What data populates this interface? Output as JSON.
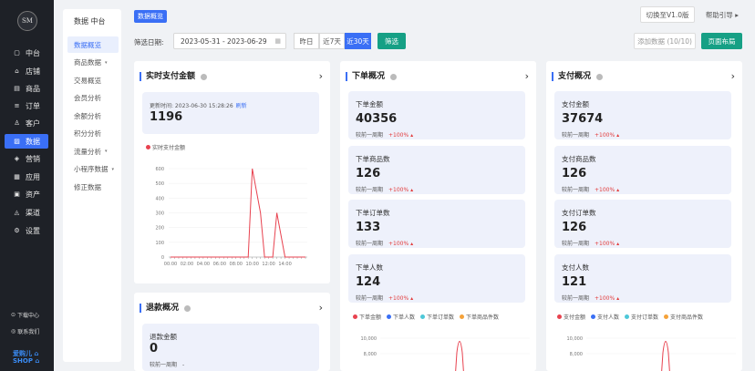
{
  "sidebar": {
    "logo": "SM",
    "items": [
      {
        "label": "中台",
        "icon": "▢"
      },
      {
        "label": "店铺",
        "icon": "⌂"
      },
      {
        "label": "商品",
        "icon": "▤"
      },
      {
        "label": "订单",
        "icon": "≡"
      },
      {
        "label": "客户",
        "icon": "♙"
      },
      {
        "label": "数据",
        "icon": "▨"
      },
      {
        "label": "营销",
        "icon": "◈"
      },
      {
        "label": "应用",
        "icon": "▦"
      },
      {
        "label": "资产",
        "icon": "▣"
      },
      {
        "label": "渠道",
        "icon": "◬"
      },
      {
        "label": "设置",
        "icon": "⚙"
      }
    ],
    "download": "下载中心",
    "contact": "联系我们",
    "brand_line1": "爱购儿 ⌂",
    "brand_line2": "SHOP ⌂"
  },
  "subnav": {
    "title": "数据 中台",
    "items": [
      {
        "label": "数据概览",
        "caret": ""
      },
      {
        "label": "商品数据",
        "caret": "▾"
      },
      {
        "label": "交易概览",
        "caret": ""
      },
      {
        "label": "会员分析",
        "caret": ""
      },
      {
        "label": "余额分析",
        "caret": ""
      },
      {
        "label": "积分分析",
        "caret": ""
      },
      {
        "label": "流量分析",
        "caret": "▾"
      },
      {
        "label": "小程序数据",
        "caret": "▾"
      },
      {
        "label": "修正数据",
        "caret": ""
      }
    ]
  },
  "header": {
    "tag": "数据概览",
    "filter_label": "筛选日期:",
    "date_range": "2023-05-31 - 2023-06-29",
    "seg_yesterday": "昨日",
    "seg_7": "近7天",
    "seg_30": "近30天",
    "filter_button": "筛选",
    "switch_version": "切换至V1.0版",
    "help": "帮助引导 ▸",
    "add_data": "添加数据 (10/10)",
    "layout": "页面布局"
  },
  "realtime": {
    "title": "实时支付金额",
    "updated": "更新时间: 2023-06-30 15:28:26",
    "refresh": "刷新",
    "value": "1196",
    "legend": "实时支付金额"
  },
  "orders": {
    "title": "下单概况",
    "cards": [
      {
        "label": "下单金额",
        "value": "40356",
        "cmp": "较前一周期",
        "pct": "+100% ▴"
      },
      {
        "label": "下单商品数",
        "value": "126",
        "cmp": "较前一周期",
        "pct": "+100% ▴"
      },
      {
        "label": "下单订单数",
        "value": "133",
        "cmp": "较前一周期",
        "pct": "+100% ▴"
      },
      {
        "label": "下单人数",
        "value": "124",
        "cmp": "较前一周期",
        "pct": "+100% ▴"
      }
    ],
    "legend": [
      "下单金额",
      "下单人数",
      "下单订单数",
      "下单商品件数"
    ]
  },
  "payments": {
    "title": "支付概况",
    "cards": [
      {
        "label": "支付金额",
        "value": "37674",
        "cmp": "较前一周期",
        "pct": "+100% ▴"
      },
      {
        "label": "支付商品数",
        "value": "126",
        "cmp": "较前一周期",
        "pct": "+100% ▴"
      },
      {
        "label": "支付订单数",
        "value": "126",
        "cmp": "较前一周期",
        "pct": "+100% ▴"
      },
      {
        "label": "支付人数",
        "value": "121",
        "cmp": "较前一周期",
        "pct": "+100% ▴"
      }
    ],
    "legend": [
      "支付金额",
      "支付人数",
      "支付订单数",
      "支付商品件数"
    ]
  },
  "refund": {
    "title": "退款概况",
    "card_label": "退款金额",
    "card_value": "0",
    "card_cmp": "较前一周期",
    "card_pct": "-"
  },
  "colors": {
    "accent": "#3a6ff5",
    "green": "#16a085",
    "line": "#e8424f",
    "up": "#e23c3c",
    "legend_blue": "#3a6ff5",
    "legend_cyan": "#4ec8d8",
    "legend_orange": "#f5a23a"
  },
  "chart_data": [
    {
      "type": "line",
      "title": "",
      "series": [
        {
          "name": "实时支付金额",
          "values": [
            0,
            0,
            0,
            0,
            0,
            0,
            0,
            0,
            0,
            0,
            0,
            0,
            0,
            0,
            0,
            0,
            0,
            0,
            0,
            0,
            600,
            450,
            300,
            0,
            0,
            0,
            300,
            150,
            0,
            0,
            0,
            0,
            0,
            0
          ]
        }
      ],
      "x": [
        "00:00",
        "",
        "02:00",
        "",
        "04:00",
        "",
        "06:00",
        "",
        "08:00",
        "",
        "10:00",
        "",
        "12:00",
        "",
        "14:00"
      ],
      "x_ticks": [
        "00:00",
        "02:00",
        "04:00",
        "06:00",
        "08:00",
        "10:00",
        "12:00",
        "14:00"
      ],
      "y_ticks": [
        "0",
        "100",
        "200",
        "300",
        "400",
        "500",
        "600"
      ],
      "ylim": [
        0,
        600
      ]
    },
    {
      "type": "line",
      "title": "",
      "y_ticks": [
        "10,000",
        "8,000"
      ],
      "series": [
        {
          "name": "下单金额"
        }
      ]
    },
    {
      "type": "line",
      "title": "",
      "y_ticks": [
        "10,000",
        "8,000"
      ],
      "series": [
        {
          "name": "支付金额"
        }
      ]
    }
  ]
}
